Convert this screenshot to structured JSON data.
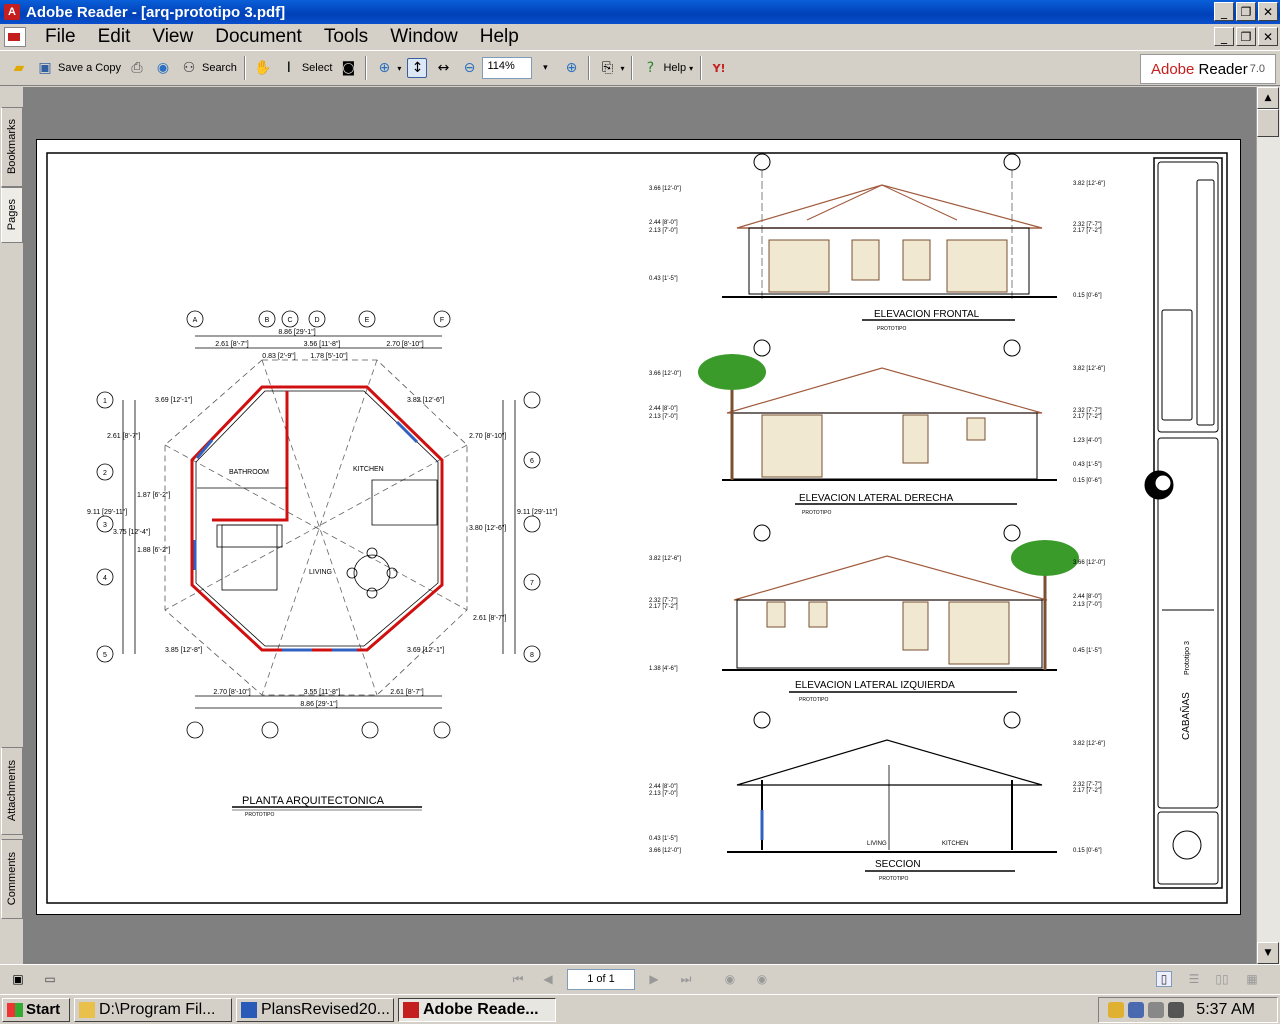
{
  "window": {
    "title": "Adobe Reader - [arq-prototipo 3.pdf]"
  },
  "menu": [
    "File",
    "Edit",
    "View",
    "Document",
    "Tools",
    "Window",
    "Help"
  ],
  "toolbar": {
    "save_copy": "Save a Copy",
    "search": "Search",
    "select": "Select",
    "zoom_value": "114%",
    "help": "Help",
    "brand_adobe": "Adobe",
    "brand_reader": "Reader",
    "brand_version": "7.0"
  },
  "nav_tabs": {
    "bookmarks": "Bookmarks",
    "pages": "Pages",
    "attachments": "Attachments",
    "comments": "Comments"
  },
  "status": {
    "page_indicator": "1 of 1"
  },
  "drawing": {
    "floorplan_title": "PLANTA ARQUITECTONICA",
    "floorplan_sub": "PROTOTIPO",
    "rooms": [
      "BATHROOM",
      "KITCHEN",
      "LIVING"
    ],
    "elev_front": "ELEVACION FRONTAL",
    "elev_right": "ELEVACION LATERAL DERECHA",
    "elev_left": "ELEVACION LATERAL IZQUIERDA",
    "section": "SECCION",
    "section_rooms": [
      "LIVING",
      "KITCHEN"
    ],
    "elev_sub": "PROTOTIPO",
    "dims_top": [
      "8.86 [29'-1\"]",
      "2.61 [8'-7\"]",
      "3.56 [11'-8\"]",
      "2.70 [8'-10\"]",
      "0.83 [2'-9\"]",
      "1.78 [5'-10\"]"
    ],
    "dims_bottom": [
      "2.70 [8'-10\"]",
      "3.55 [11'-8\"]",
      "2.61 [8'-7\"]",
      "8.86 [29'-1\"]"
    ],
    "dims_left": [
      "3.69 [12'-1\"]",
      "2.61 [8'-7\"]",
      "1.87 [6'-2\"]",
      "9.11 [29'-11\"]",
      "3.75 [12'-4\"]",
      "1.88 [6'-2\"]",
      "3.85 [12'-8\"]"
    ],
    "dims_right": [
      "3.82 [12'-6\"]",
      "2.70 [8'-10\"]",
      "9.11 [29'-11\"]",
      "3.80 [12'-6\"]",
      "2.61 [8'-7\"]",
      "3.69 [12'-1\"]"
    ],
    "levels_front_left": [
      "3.66 [12'-0\"]",
      "2.44 [8'-0\"]",
      "2.13 [7'-0\"]",
      "0.43 [1'-5\"]"
    ],
    "levels_front_right": [
      "3.82 [12'-6\"]",
      "2.32 [7'-7\"]",
      "2.17 [7'-2\"]",
      "0.15 [0'-6\"]"
    ],
    "levels_right_left": [
      "3.66 [12'-0\"]",
      "2.44 [8'-0\"]",
      "2.13 [7'-0\"]"
    ],
    "levels_right_right": [
      "3.82 [12'-6\"]",
      "2.32 [7'-7\"]",
      "2.17 [7'-2\"]",
      "1.23 [4'-0\"]",
      "0.43 [1'-5\"]",
      "0.15 [0'-6\"]"
    ],
    "levels_left_left": [
      "3.82 [12'-6\"]",
      "2.32 [7'-7\"]",
      "2.17 [7'-2\"]",
      "1.38 [4'-6\"]"
    ],
    "levels_left_right": [
      "3.66 [12'-0\"]",
      "2.44 [8'-0\"]",
      "2.13 [7'-0\"]",
      "0.45 [1'-5\"]"
    ],
    "levels_sec_left": [
      "2.44 [8'-0\"]",
      "2.13 [7'-0\"]",
      "0.43 [1'-5\"]",
      "3.66 [12'-0\"]"
    ],
    "levels_sec_right": [
      "3.82 [12'-6\"]",
      "2.32 [7'-7\"]",
      "2.17 [7'-2\"]",
      "0.15 [0'-6\"]"
    ],
    "axis_labels": [
      "A",
      "B",
      "C",
      "D",
      "E",
      "F",
      "1",
      "2",
      "3",
      "4",
      "5",
      "6",
      "7",
      "8"
    ],
    "titleblock_project": "CABAÑAS",
    "titleblock_proto": "Prototipo 3"
  },
  "taskbar": {
    "start": "Start",
    "tasks": [
      "D:\\Program Fil...",
      "PlansRevised20...",
      "Adobe Reade..."
    ],
    "clock": "5:37 AM"
  }
}
